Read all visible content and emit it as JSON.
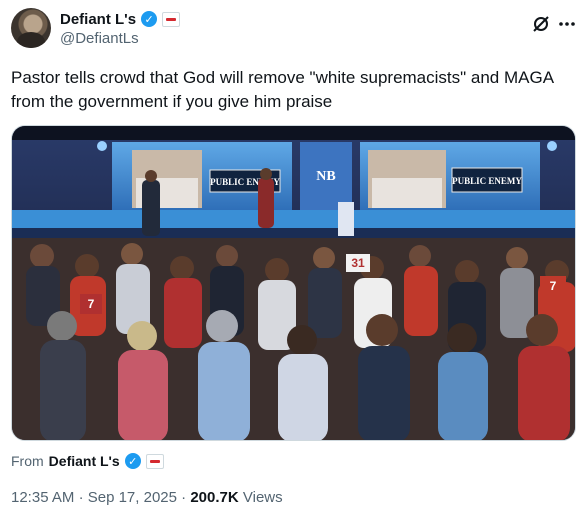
{
  "author": {
    "display_name": "Defiant L's",
    "handle": "@DefiantLs"
  },
  "tweet": {
    "text": "Pastor tells crowd that God will remove \"white supremacists\" and MAGA from the government if you give him praise"
  },
  "media": {
    "stage_sign_left": "PUBLIC ENEMY",
    "stage_sign_right": "PUBLIC ENEMY",
    "podium_logo": "NB",
    "jersey_numbers": [
      "31",
      "7",
      "7"
    ]
  },
  "source": {
    "prefix": "From",
    "name": "Defiant L's"
  },
  "meta": {
    "time": "12:35 AM",
    "sep": "·",
    "date": "Sep 17, 2025",
    "views_count": "200.7K",
    "views_label": "Views"
  },
  "colors": {
    "verified": "#1d9bf0",
    "secondary_text": "#536471"
  }
}
